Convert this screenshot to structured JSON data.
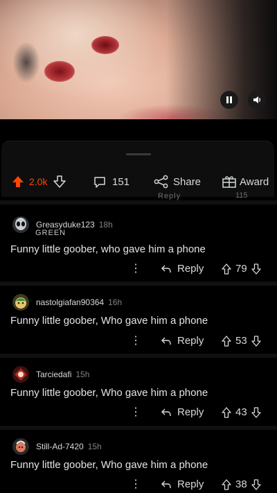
{
  "video": {
    "pause_icon": "pause-icon",
    "volume_icon": "volume-icon"
  },
  "actions": {
    "upvote_count": "2.0k",
    "comment_count": "151",
    "share_label": "Share",
    "award_label": "Award",
    "accent": "#ff4500"
  },
  "ghost_text": {
    "reply": "Reply",
    "count": "115"
  },
  "comments": [
    {
      "username": "Greasyduke123",
      "time": "18h",
      "flair": "GREEN",
      "body": "Funny little goober, who gave him a phone",
      "reply_label": "Reply",
      "votes": "79"
    },
    {
      "username": "nastolgiafan90364",
      "time": "16h",
      "body": "Funny little goober, Who gave him a phone",
      "reply_label": "Reply",
      "votes": "53"
    },
    {
      "username": "Tarciedafi",
      "time": "15h",
      "body": "Funny little goober, Who gave him a phone",
      "reply_label": "Reply",
      "votes": "43"
    },
    {
      "username": "Still-Ad-7420",
      "time": "15h",
      "body": "Funny little goober, Who gave him a phone",
      "reply_label": "Reply",
      "votes": "38"
    }
  ]
}
